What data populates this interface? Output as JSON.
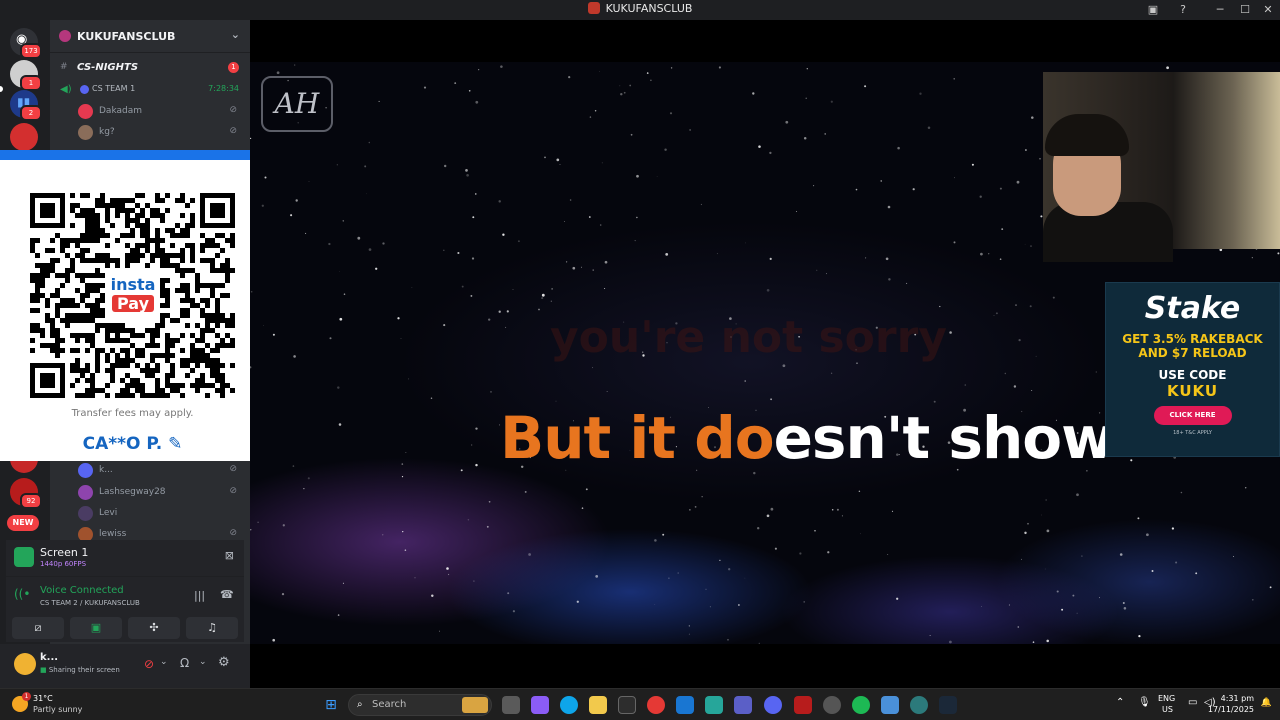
{
  "window": {
    "title": "KUKUFANSCLUB"
  },
  "rail": {
    "servers": [
      {
        "name": "discord-home",
        "badge": "173",
        "color": "#e53935"
      },
      {
        "name": "server-2",
        "badge": "1",
        "color": "#c0c0c0"
      },
      {
        "name": "server-3",
        "badge": "2",
        "color": "#3b82f6"
      },
      {
        "name": "server-4",
        "badge": "",
        "color": "#d32f2f"
      },
      {
        "name": "server-5",
        "badge": "",
        "color": "#c62828"
      },
      {
        "name": "server-6",
        "badge": "92",
        "color": "#b71c1c"
      }
    ],
    "new_label": "NEW"
  },
  "sidebar": {
    "guild_name": "KUKUFANSCLUB",
    "channel_name": "CS-NIGHTS",
    "channel_badge": "1",
    "voice_channel": "CS TEAM 1",
    "voice_timer": "7:28:34",
    "members_top": [
      "Dakadam",
      "kg?"
    ],
    "members_bottom": [
      "k...",
      "Lashsegway28",
      "Levi",
      "lewiss"
    ]
  },
  "qr_overlay": {
    "logo_top": "insta",
    "logo_bottom": "Pay",
    "fee_note": "Transfer fees may apply.",
    "account_name": "CA**O P."
  },
  "stream_panel": {
    "title": "Screen 1",
    "quality": "1440p 60FPS"
  },
  "voice_panel": {
    "status": "Voice Connected",
    "location": "CS TEAM 2 / KUKUFANSCLUB"
  },
  "user_panel": {
    "name": "k...",
    "status": "Sharing their screen"
  },
  "stream": {
    "logo_text": "AH",
    "ghost_lyric": "you're not sorry",
    "lyric_sung": "But it do",
    "lyric_unsung": "esn't show"
  },
  "stake_ad": {
    "brand": "Stake",
    "line1": "GET 3.5% RAKEBACK",
    "line2": "AND $7 RELOAD",
    "line3": "USE CODE",
    "code": "KUKU",
    "cta": "CLICK HERE",
    "fine_print": "18+ T&C APPLY"
  },
  "taskbar": {
    "weather_temp": "31°C",
    "weather_desc": "Partly sunny",
    "weather_badge": "1",
    "search_placeholder": "Search",
    "lang": "ENG",
    "region": "US",
    "time": "4:31 pm",
    "date": "17/11/2025"
  }
}
